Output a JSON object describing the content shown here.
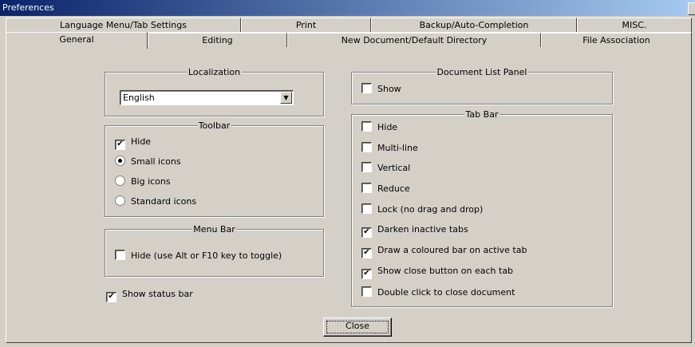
{
  "window": {
    "title": "Preferences"
  },
  "tabs_row1": [
    {
      "label": "Language Menu/Tab Settings"
    },
    {
      "label": "Print"
    },
    {
      "label": "Backup/Auto-Completion"
    },
    {
      "label": "MISC."
    }
  ],
  "tabs_row2": [
    {
      "label": "General",
      "active": true
    },
    {
      "label": "Editing"
    },
    {
      "label": "New Document/Default Directory"
    },
    {
      "label": "File Association"
    }
  ],
  "localization": {
    "legend": "Localization",
    "selected": "English"
  },
  "toolbar": {
    "legend": "Toolbar",
    "hide_label": "Hide",
    "hide_checked": true,
    "small_icons": "Small icons",
    "big_icons": "Big icons",
    "standard_icons": "Standard icons",
    "selected": "small"
  },
  "menubar": {
    "legend": "Menu Bar",
    "hide_label": "Hide (use Alt or F10 key to toggle)",
    "hide_checked": false
  },
  "status_bar": {
    "label": "Show status bar",
    "checked": true
  },
  "doclist": {
    "legend": "Document List Panel",
    "show_label": "Show",
    "show_checked": false
  },
  "tabbar": {
    "legend": "Tab Bar",
    "items": [
      {
        "label": "Hide",
        "checked": false
      },
      {
        "label": "Multi-line",
        "checked": false
      },
      {
        "label": "Vertical",
        "checked": false
      },
      {
        "label": "Reduce",
        "checked": false
      },
      {
        "label": "Lock (no drag and drop)",
        "checked": false
      },
      {
        "label": "Darken inactive tabs",
        "checked": true
      },
      {
        "label": "Draw a coloured bar on active tab",
        "checked": true
      },
      {
        "label": "Show close button on each tab",
        "checked": true
      },
      {
        "label": "Double click to close document",
        "checked": false
      }
    ]
  },
  "buttons": {
    "close": "Close"
  }
}
